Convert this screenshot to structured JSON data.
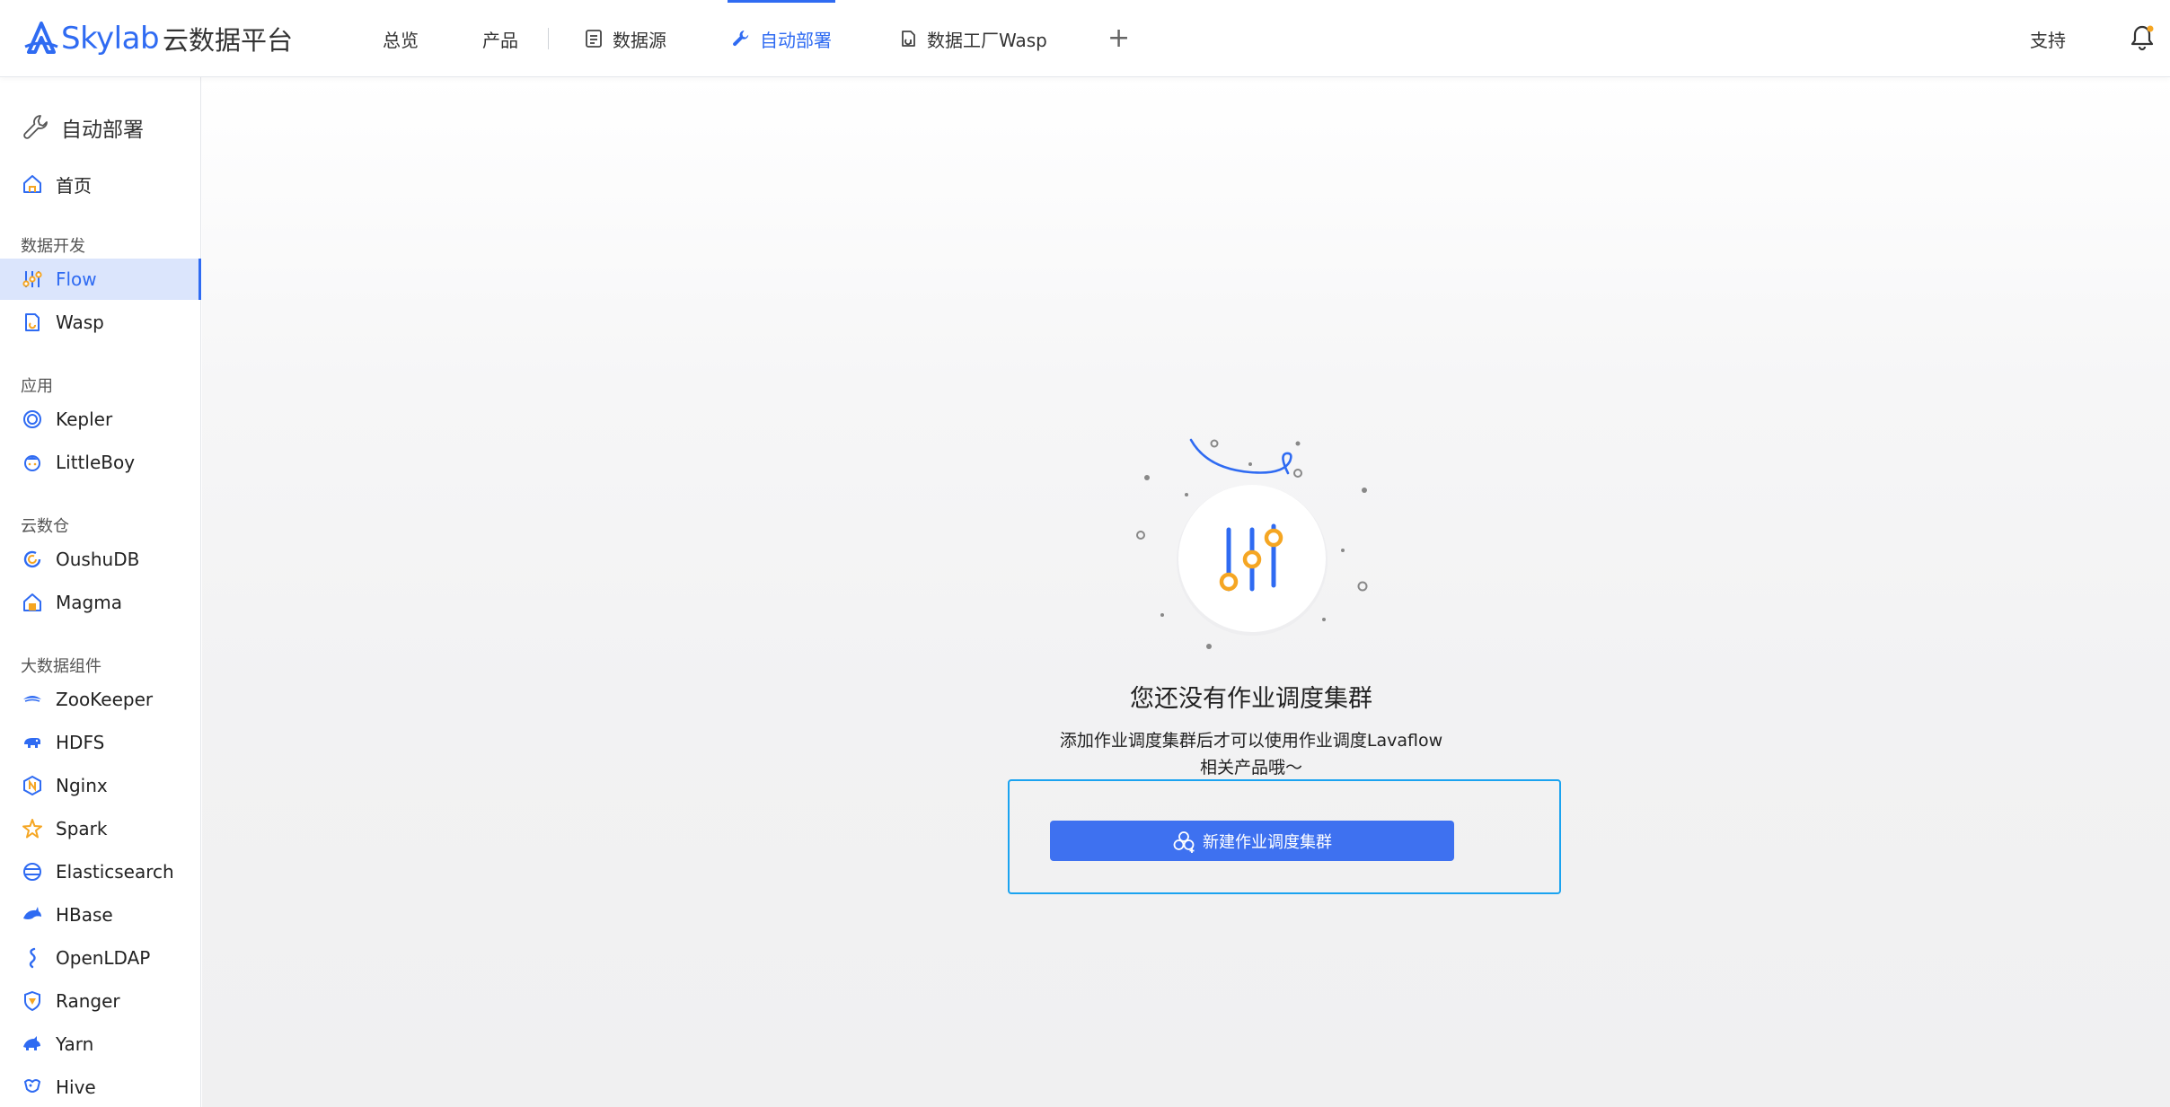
{
  "brand": {
    "logo_text": "Skylab",
    "product_name": "云数据平台",
    "accent": "#2f6bf2"
  },
  "topnav": {
    "items": [
      {
        "label": "总览"
      },
      {
        "label": "产品"
      },
      {
        "label": "数据源",
        "icon": "document-icon"
      },
      {
        "label": "自动部署",
        "icon": "wrench-icon",
        "active": true
      },
      {
        "label": "数据工厂Wasp",
        "icon": "wasp-icon"
      }
    ],
    "add_tab": "+",
    "support": "支持"
  },
  "sidebar": {
    "title": "自动部署",
    "home": "首页",
    "groups": [
      {
        "label": "数据开发",
        "items": [
          {
            "label": "Flow",
            "active": true
          },
          {
            "label": "Wasp"
          }
        ]
      },
      {
        "label": "应用",
        "items": [
          {
            "label": "Kepler"
          },
          {
            "label": "LittleBoy"
          }
        ]
      },
      {
        "label": "云数仓",
        "items": [
          {
            "label": "OushuDB"
          },
          {
            "label": "Magma"
          }
        ]
      },
      {
        "label": "大数据组件",
        "items": [
          {
            "label": "ZooKeeper"
          },
          {
            "label": "HDFS"
          },
          {
            "label": "Nginx"
          },
          {
            "label": "Spark"
          },
          {
            "label": "Elasticsearch"
          },
          {
            "label": "HBase"
          },
          {
            "label": "OpenLDAP"
          },
          {
            "label": "Ranger"
          },
          {
            "label": "Yarn"
          },
          {
            "label": "Hive"
          }
        ]
      }
    ]
  },
  "empty_state": {
    "title": "您还没有作业调度集群",
    "description_line1": "添加作业调度集群后才可以使用作业调度Lavaflow",
    "description_line2": "相关产品哦～",
    "button_label": "新建作业调度集群",
    "button_color": "#3e71f0",
    "illustration_icon": "sliders-icon"
  }
}
